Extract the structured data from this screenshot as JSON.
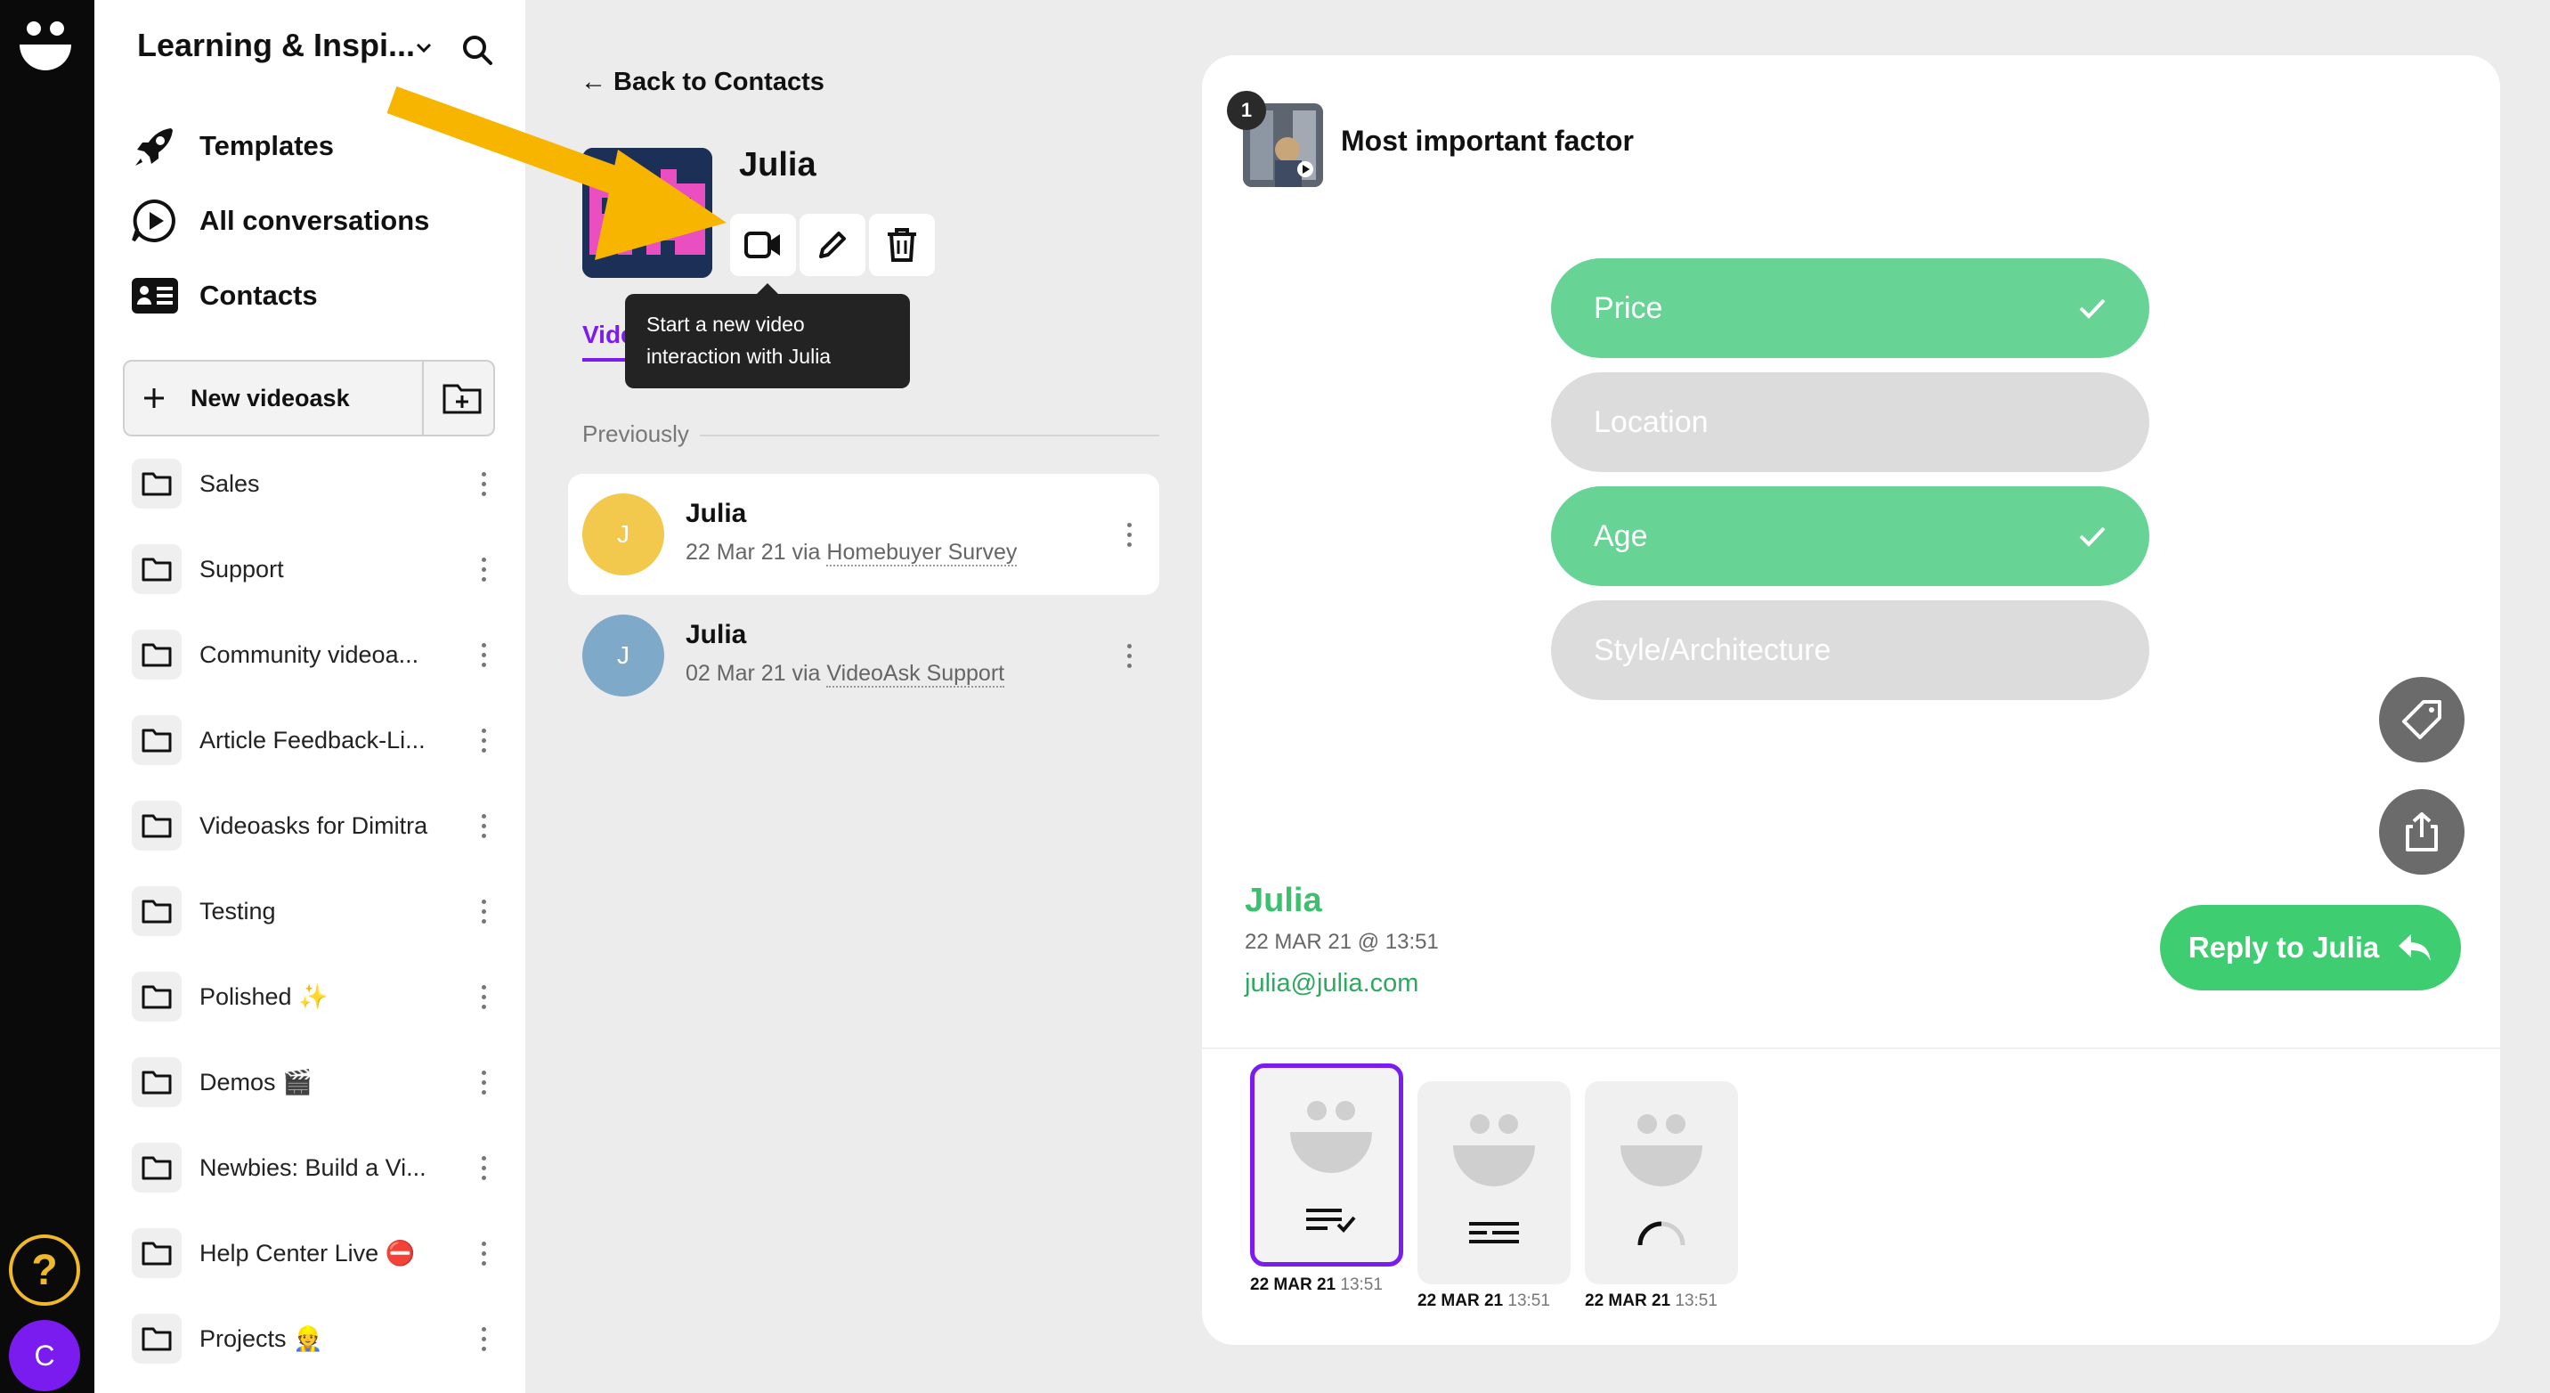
{
  "workspace": {
    "title": "Learning & Inspi..."
  },
  "nav": {
    "templates": "Templates",
    "all_conversations": "All conversations",
    "contacts": "Contacts"
  },
  "new_videoask": {
    "label": "New videoask"
  },
  "folders": [
    {
      "label": "Sales"
    },
    {
      "label": "Support"
    },
    {
      "label": "Community videoa..."
    },
    {
      "label": "Article Feedback-Li..."
    },
    {
      "label": "Videoasks for Dimitra"
    },
    {
      "label": "Testing"
    },
    {
      "label": "Polished ✨"
    },
    {
      "label": "Demos 🎬"
    },
    {
      "label": "Newbies: Build a Vi..."
    },
    {
      "label": "Help Center Live ⛔"
    },
    {
      "label": "Projects 👷"
    }
  ],
  "rail": {
    "help": "?",
    "user_initial": "C"
  },
  "contact": {
    "back_label": "Back to Contacts",
    "name": "Julia",
    "tooltip": "Start a new video interaction with Julia",
    "tab": "Vide",
    "previously": "Previously",
    "conversations": [
      {
        "initial": "J",
        "name": "Julia",
        "date": "22 Mar 21 via ",
        "source": "Homebuyer Survey",
        "color": "#f2c94c"
      },
      {
        "initial": "J",
        "name": "Julia",
        "date": "02 Mar 21 via ",
        "source": "VideoAsk Support",
        "color": "#7fa9c8"
      }
    ]
  },
  "question": {
    "number": "1",
    "title": "Most important factor",
    "options": [
      {
        "label": "Price",
        "selected": true
      },
      {
        "label": "Location",
        "selected": false
      },
      {
        "label": "Age",
        "selected": true
      },
      {
        "label": "Style/Architecture",
        "selected": false
      }
    ]
  },
  "response": {
    "name": "Julia",
    "datetime": "22 MAR 21 @ 13:51",
    "email": "julia@julia.com",
    "reply_label": "Reply to Julia"
  },
  "thumbnails": [
    {
      "date": "22 MAR 21",
      "time": "13:51",
      "icon": "multiple-choice-icon",
      "selected": true
    },
    {
      "date": "22 MAR 21",
      "time": "13:51",
      "icon": "text-form-icon",
      "selected": false
    },
    {
      "date": "22 MAR 21",
      "time": "13:51",
      "icon": "loading-icon",
      "selected": false
    }
  ],
  "colors": {
    "accent": "#7a1cf0",
    "green": "#67d394",
    "reply": "#3fcd72",
    "arrow": "#f7b500"
  }
}
